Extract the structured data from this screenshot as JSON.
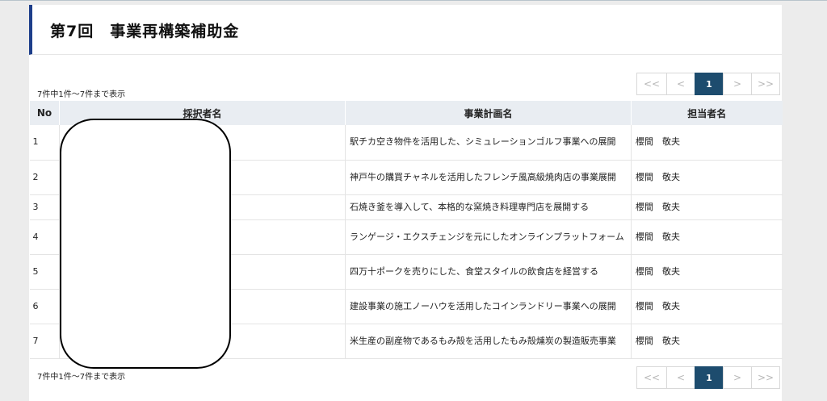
{
  "page": {
    "title": "第7回　事業再構築補助金",
    "count_top": "7件中1件～7件まで表示",
    "count_bottom": "7件中1件～7件まで表示"
  },
  "pagination": {
    "first": "<<",
    "prev": "<",
    "current": "1",
    "next": ">",
    "last": ">>"
  },
  "table": {
    "headers": {
      "no": "No",
      "applicant": "採択者名",
      "plan": "事業計画名",
      "manager": "担当者名"
    },
    "rows": [
      {
        "no": "1",
        "applicant": "",
        "plan": "駅チカ空き物件を活用した、シミュレーションゴルフ事業への展開",
        "manager": "櫻間　敬夫"
      },
      {
        "no": "2",
        "applicant": "",
        "plan": "神戸牛の購買チャネルを活用したフレンチ風高級焼肉店の事業展開",
        "manager": "櫻間　敬夫"
      },
      {
        "no": "3",
        "applicant": "",
        "plan": "石焼き釜を導入して、本格的な窯焼き料理専門店を展開する",
        "manager": "櫻間　敬夫"
      },
      {
        "no": "4",
        "applicant": "",
        "plan": "ランゲージ・エクスチェンジを元にしたオンラインプラットフォーム",
        "manager": "櫻間　敬夫"
      },
      {
        "no": "5",
        "applicant": "",
        "plan": "四万十ポークを売りにした、食堂スタイルの飲食店を経営する",
        "manager": "櫻間　敬夫"
      },
      {
        "no": "6",
        "applicant": "",
        "plan": "建設事業の施工ノーハウを活用したコインランドリー事業への展開",
        "manager": "櫻間　敬夫"
      },
      {
        "no": "7",
        "applicant": "",
        "plan": "米生産の副産物であるもみ殻を活用したもみ殻燻炭の製造販売事業",
        "manager": "櫻間　敬夫"
      }
    ]
  }
}
